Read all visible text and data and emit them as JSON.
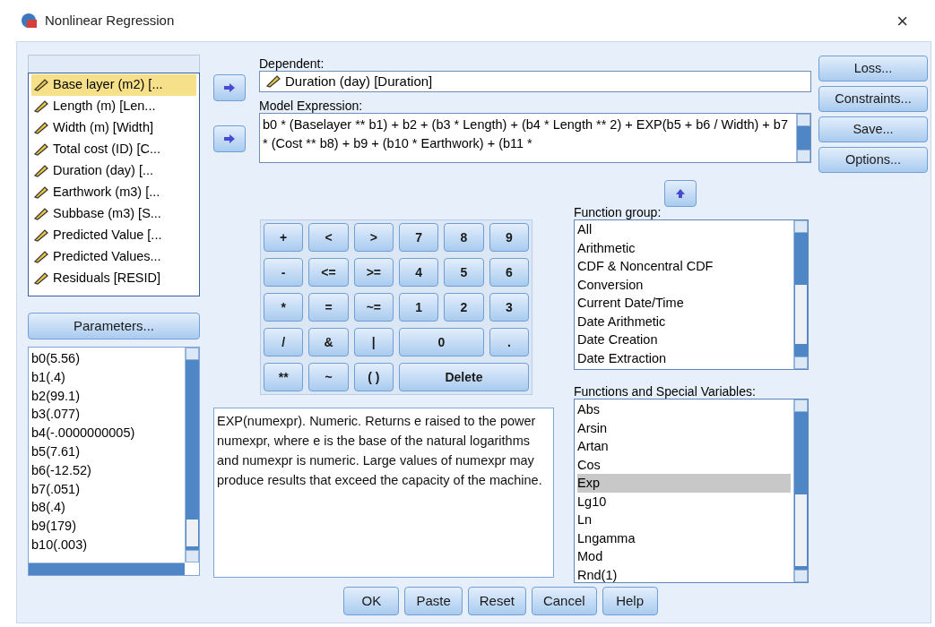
{
  "window": {
    "title": "Nonlinear Regression",
    "close": "×"
  },
  "variables": [
    {
      "label": "Base layer (m2) [...",
      "selected": true
    },
    {
      "label": "Length (m) [Len...",
      "selected": false
    },
    {
      "label": "Width (m) [Width]",
      "selected": false
    },
    {
      "label": "Total cost (ID) [C...",
      "selected": false
    },
    {
      "label": "Duration (day) [...",
      "selected": false
    },
    {
      "label": "Earthwork (m3) [...",
      "selected": false
    },
    {
      "label": "Subbase (m3) [S...",
      "selected": false
    },
    {
      "label": "Predicted Value [...",
      "selected": false
    },
    {
      "label": "Predicted Values...",
      "selected": false
    },
    {
      "label": "Residuals [RESID]",
      "selected": false
    }
  ],
  "parameters_button": "Parameters...",
  "parameters": [
    "b0(5.56)",
    "b1(.4)",
    "b2(99.1)",
    "b3(.077)",
    "b4(-.0000000005)",
    "b5(7.61)",
    "b6(-12.52)",
    "b7(.051)",
    "b8(.4)",
    "b9(179)",
    "b10(.003)"
  ],
  "dependent": {
    "label": "Dependent:",
    "value": "Duration (day) [Duration]"
  },
  "model_expression": {
    "label": "Model Expression:",
    "value": "b0 * (Baselayer ** b1) + b2 + (b3 * Length) + (b4 * Length ** 2) +  EXP(b5 + b6 / Width) +  b7 * (Cost ** b8) + b9 + (b10 * Earthwork) + (b11 *"
  },
  "side_buttons": [
    "Loss...",
    "Constraints...",
    "Save...",
    "Options..."
  ],
  "keypad": [
    {
      "label": "+",
      "kind": "key"
    },
    {
      "label": "<",
      "kind": "key"
    },
    {
      "label": ">",
      "kind": "key"
    },
    {
      "label": "7",
      "kind": "key"
    },
    {
      "label": "8",
      "kind": "key"
    },
    {
      "label": "9",
      "kind": "key"
    },
    {
      "label": "-",
      "kind": "key"
    },
    {
      "label": "<=",
      "kind": "key"
    },
    {
      "label": ">=",
      "kind": "key"
    },
    {
      "label": "4",
      "kind": "key"
    },
    {
      "label": "5",
      "kind": "key"
    },
    {
      "label": "6",
      "kind": "key"
    },
    {
      "label": "*",
      "kind": "key"
    },
    {
      "label": "=",
      "kind": "key"
    },
    {
      "label": "~=",
      "kind": "key"
    },
    {
      "label": "1",
      "kind": "key"
    },
    {
      "label": "2",
      "kind": "key"
    },
    {
      "label": "3",
      "kind": "key"
    },
    {
      "label": "/",
      "kind": "key"
    },
    {
      "label": "&",
      "kind": "key"
    },
    {
      "label": "|",
      "kind": "key"
    },
    {
      "label": "0",
      "kind": "wide"
    },
    {
      "label": ".",
      "kind": "key"
    },
    {
      "label": "**",
      "kind": "key"
    },
    {
      "label": "~",
      "kind": "key"
    },
    {
      "label": "( )",
      "kind": "key"
    },
    {
      "label": "Delete",
      "kind": "wider"
    }
  ],
  "description": "EXP(numexpr). Numeric. Returns e raised to the power numexpr, where e is the base of the natural logarithms and numexpr is numeric. Large values of numexpr may produce results that exceed the capacity of the machine.",
  "function_group": {
    "label": "Function group:",
    "items": [
      {
        "label": "All",
        "selected": false
      },
      {
        "label": "Arithmetic",
        "selected": false
      },
      {
        "label": "CDF & Noncentral CDF",
        "selected": false
      },
      {
        "label": "Conversion",
        "selected": false
      },
      {
        "label": "Current Date/Time",
        "selected": false
      },
      {
        "label": "Date Arithmetic",
        "selected": false
      },
      {
        "label": "Date Creation",
        "selected": false
      },
      {
        "label": "Date Extraction",
        "selected": false
      }
    ]
  },
  "functions": {
    "label": "Functions and Special Variables:",
    "items": [
      {
        "label": "Abs",
        "selected": false
      },
      {
        "label": "Arsin",
        "selected": false
      },
      {
        "label": "Artan",
        "selected": false
      },
      {
        "label": "Cos",
        "selected": false
      },
      {
        "label": "Exp",
        "selected": true
      },
      {
        "label": "Lg10",
        "selected": false
      },
      {
        "label": "Ln",
        "selected": false
      },
      {
        "label": "Lngamma",
        "selected": false
      },
      {
        "label": "Mod",
        "selected": false
      },
      {
        "label": "Rnd(1)",
        "selected": false
      }
    ]
  },
  "footer_buttons": [
    "OK",
    "Paste",
    "Reset",
    "Cancel",
    "Help"
  ]
}
